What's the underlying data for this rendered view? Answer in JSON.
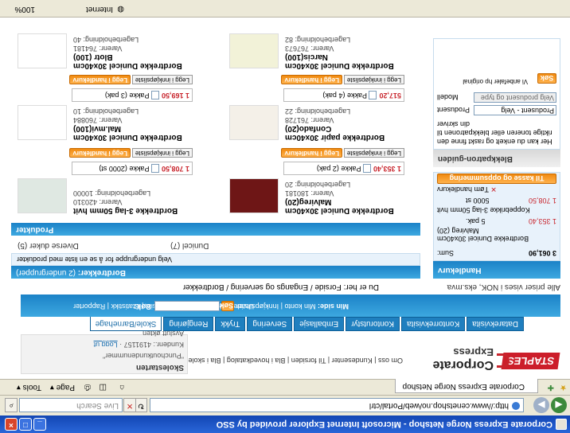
{
  "window": {
    "title": "Corporate Express Norge Netshop - Microsoft Internet Explorer provided by SSO"
  },
  "browser": {
    "url": "http://www.cenetshop.no/web/Portal/ctrl",
    "search_placeholder": "Live Search",
    "tab_title": "Corporate Express Norge Netshop",
    "cmd_home": "",
    "cmd_page": "Page",
    "cmd_tools": "Tools",
    "status_zone": "Internet",
    "zoom": "100%"
  },
  "header": {
    "logo_line1": "Corporate",
    "logo_line2": "Express",
    "staples": "STAPLES",
    "top_links": "Om oss | Kundesenter | Til forsiden | Bla i hovedkatalog | Bla i skolekatalog",
    "customer_name": "Skolestarten",
    "customer_label": "\"Punchoutkundenummer\"",
    "customer_no": "Kundenr.: 4191157",
    "logout": "Logg ut",
    "end_session": "Avslutt økten"
  },
  "nav": {
    "tabs": [
      "Skole/Barnehage",
      "Rengjøring",
      "Trykk",
      "Servering",
      "Emballasje",
      "Kontorutstyr",
      "Kontorrekvisita",
      "Datarekvisita"
    ],
    "active": 0
  },
  "searchbar": {
    "label": "Søk:",
    "button": "Søk",
    "advanced": "Utvidet søk",
    "my_page_label": "Min side:",
    "my_page_links": "Min konto | Innkjøpslister | Innstillinger | Ordreoversikt | Statistikk | Rapporter"
  },
  "breadcrumb": {
    "text": "Du er her: Forside / Engangs og servering / Bordtrekker",
    "prices_note": "Alle priser vises i NOK, eks.mva"
  },
  "category": {
    "header": "Bordtrekker:",
    "header_sub": "(2 undergrupper)",
    "hint": "Velg undergruppe for å se en liste med produkter",
    "links": [
      "Diverse duker (5)",
      "Dunicel (7)"
    ]
  },
  "products_header": "Produkter",
  "products": [
    {
      "name": "Bordtrekke 3-lag 50mm hvit",
      "varenr": "Varenr: 420310",
      "lager": "Lagerbeholdning: 10000",
      "price": "1 708,50",
      "unit": "Pakke (2000 st)",
      "thumb": "#dfe8e2"
    },
    {
      "name": "Bordtrekke Dunicel 30x40cm",
      "name2": "Malvireg(20)",
      "varenr": "Varenr: 180181",
      "lager": "Lagerbeholdning: 20",
      "price": "1 353,40",
      "unit": "Pakke (2 pak)",
      "thumb": "#6e1616"
    },
    {
      "name": "Bordtrekke Dunicel 30x40cm",
      "name2": "Mal.mvi(100)",
      "varenr": "Varenr: 760884",
      "lager": "Lagerbeholdning: 10",
      "price": "1 169,50",
      "unit": "Pakke (3 pak)",
      "thumb": "#ffffff"
    },
    {
      "name": "Bordtrekke papir 30x40cm",
      "name2": "Confado(20)",
      "varenr": "Varenr: 761728",
      "lager": "Lagerbeholdning: 22",
      "price": "517,20",
      "unit": "Pakke (4 pak)",
      "thumb": "#f4f0e8"
    },
    {
      "name": "Bordtrekke Dunicel 30x40cm",
      "name2": "Blotr (100)",
      "varenr": "Varenr: 764181",
      "lager": "Lagerbeholdning: 40",
      "price": "",
      "unit": "",
      "thumb": "#ffffff"
    },
    {
      "name": "Bordtrekke Dunicel 30x40cm",
      "name2": "Narcis(100)",
      "varenr": "Varenr: 767673",
      "lager": "Lagerbeholdning: 82",
      "price": "",
      "unit": "",
      "thumb": "#f2f2d8"
    }
  ],
  "buttons": {
    "add_cart": "Legg i handlekurv",
    "add_list": "Legg i innkjøpsliste"
  },
  "cart": {
    "title": "Handlekurv",
    "sum_label": "Sum:",
    "sum": "3 061,90",
    "items": [
      {
        "name": "Bordtrekke Dunicel 30x40cm Malvireg (20)",
        "qty": "5 pak.",
        "price": "1 353,40"
      },
      {
        "name": "Koppebrikke 3-lag 50mm hvit",
        "qty": "5000 st",
        "price": "1 708,50"
      }
    ],
    "empty": "Tøm handlekurv",
    "checkout": "Til kasse og oppsummering"
  },
  "ink": {
    "title": "Blekkpatron-guiden",
    "desc": "Her kan du enkelt og raskt finne den riktige toneren eller blekkpatronen til din skriver",
    "prod_label": "Produsent",
    "prod_val": "Produsent - Velg",
    "model_label": "Modell",
    "model_val": "Velg produsent og type",
    "search": "Søk",
    "ad": "Vi anbefaler hp original"
  }
}
